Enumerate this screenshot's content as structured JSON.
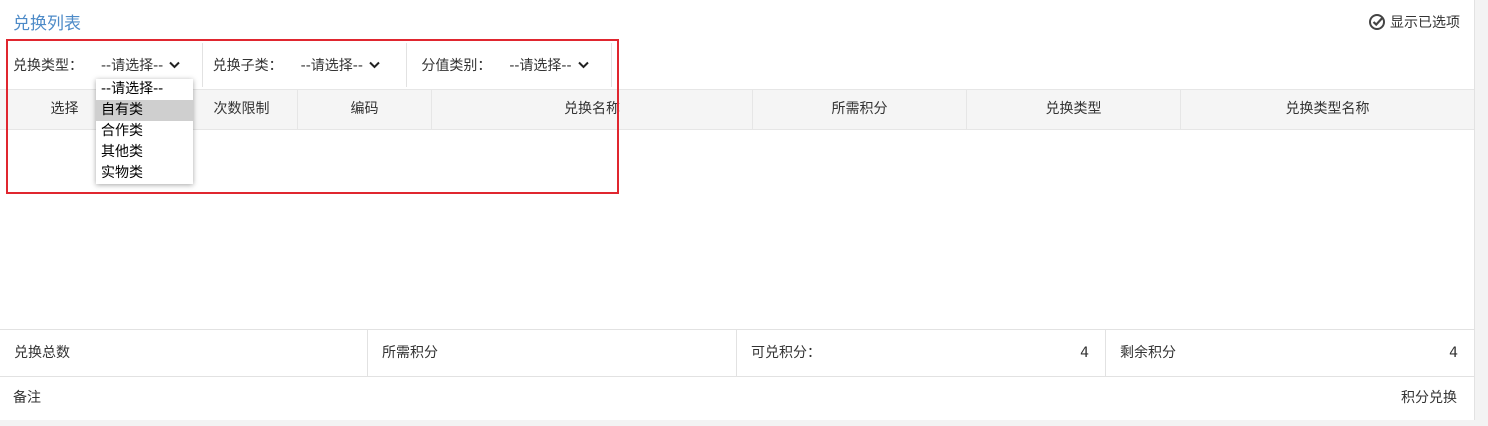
{
  "title": "兑换列表",
  "show_selected": "显示已选项",
  "filters": [
    {
      "label": "兑换类型：",
      "value": "--请选择--"
    },
    {
      "label": "兑换子类：",
      "value": "--请选择--"
    },
    {
      "label": "分值类别：",
      "value": "--请选择--"
    }
  ],
  "columns": [
    "选择",
    "次数限制",
    "编码",
    "兑换名称",
    "所需积分",
    "兑换类型",
    "兑换类型名称"
  ],
  "dropdown": {
    "options": [
      "--请选择--",
      "自有类",
      "合作类",
      "其他类",
      "实物类"
    ],
    "highlighted": "自有类"
  },
  "summary": {
    "total_label": "兑换总数",
    "required_label": "所需积分",
    "available_label": "可兑积分：",
    "available_value": "4",
    "remaining_label": "剩余积分",
    "remaining_value": "4"
  },
  "footer": {
    "remark_label": "备注",
    "exchange_button": "积分兑换"
  },
  "colors": {
    "title": "#4e8bc8",
    "highlight_border": "#e0262f",
    "header_bg": "#f5f5f5",
    "dropdown_highlight": "#cfcfcf"
  }
}
